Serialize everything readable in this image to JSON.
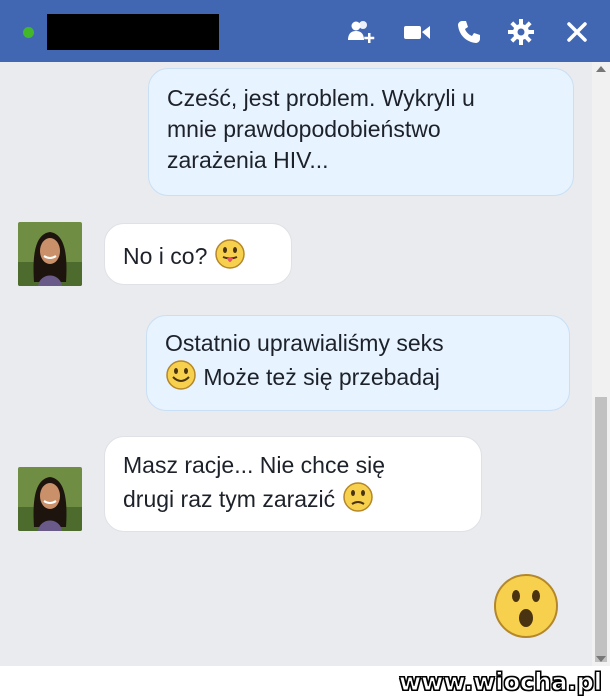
{
  "header": {
    "colors": {
      "bar": "#4267b2",
      "online": "#42b72a"
    },
    "icons": [
      "add-people-icon",
      "video-call-icon",
      "phone-icon",
      "gear-icon",
      "close-icon"
    ]
  },
  "messages": [
    {
      "side": "out",
      "lines": [
        "Cześć, jest problem. Wykryli u",
        "mnie prawdopodobieństwo",
        "zarażenia HIV..."
      ]
    },
    {
      "side": "in",
      "text": "No i co?",
      "emoji": "tongue-out-emoji"
    },
    {
      "side": "out",
      "line1": "Ostatnio uprawialiśmy seks",
      "emoji": "smile-emoji",
      "line2": "Może też się przebadaj"
    },
    {
      "side": "in",
      "line1": "Masz racje... Nie chce się",
      "line2": "drugi raz tym zarazić",
      "emoji": "frown-emoji"
    },
    {
      "side": "out",
      "emoji": "shocked-emoji"
    }
  ],
  "watermark": "www.wiocha.pl"
}
